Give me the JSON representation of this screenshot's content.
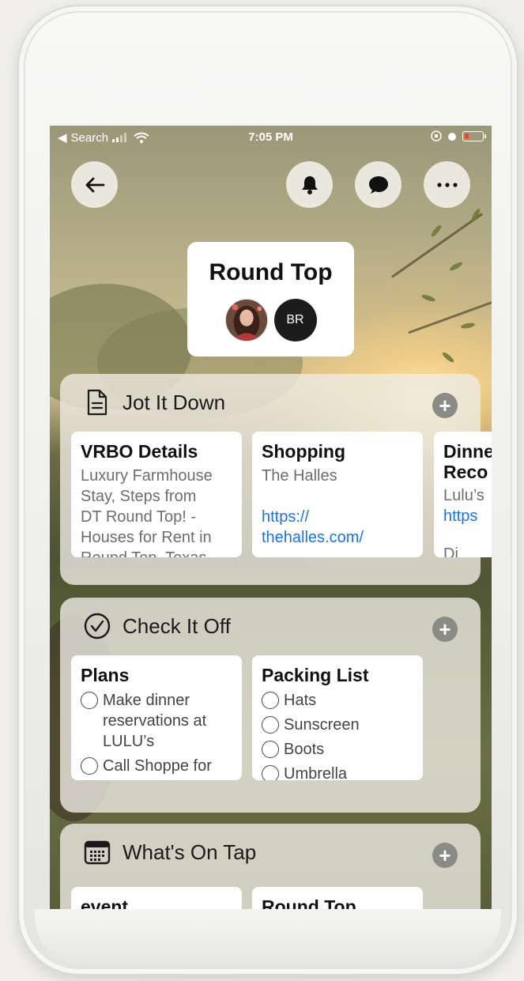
{
  "status_bar": {
    "back_app": "Search",
    "time": "7:05 PM"
  },
  "header": {
    "back_icon": "arrow-left-icon",
    "bell_icon": "bell-icon",
    "chat_icon": "chat-bubble-icon",
    "more_icon": "more-horizontal-icon"
  },
  "trip": {
    "title": "Round Top",
    "members": [
      {
        "type": "photo"
      },
      {
        "type": "initials",
        "initials": "BR"
      }
    ]
  },
  "sections": {
    "jot": {
      "title": "Jot It Down",
      "icon": "document-icon",
      "cards": [
        {
          "title": "VRBO Details",
          "lines": [
            "Luxury Farmhouse",
            "Stay, Steps from",
            "DT Round Top! -",
            "Houses for Rent in",
            "Round Top, Texas"
          ]
        },
        {
          "title": "Shopping",
          "lines": [
            "The Halles"
          ],
          "link_lines": [
            "https://",
            "thehalles.com/"
          ]
        },
        {
          "title_lines": [
            "Dinner",
            "Reco"
          ],
          "lines": [
            "Lulu’s"
          ],
          "link_lines": [
            "https"
          ],
          "tail": "Di"
        }
      ]
    },
    "check": {
      "title": "Check It Off",
      "icon": "checkmark-circle-icon",
      "cards": [
        {
          "title": "Plans",
          "items": [
            [
              "Make dinner",
              "reservations at",
              "LULU’s"
            ],
            [
              "Call Shoppe for"
            ]
          ]
        },
        {
          "title": "Packing List",
          "items": [
            [
              "Hats"
            ],
            [
              "Sunscreen"
            ],
            [
              "Boots"
            ],
            [
              "Umbrella"
            ]
          ]
        }
      ]
    },
    "tap": {
      "title": "What's On Tap",
      "icon": "calendar-icon",
      "cards": [
        {
          "title": "event"
        },
        {
          "title": "Round Top"
        }
      ]
    }
  }
}
